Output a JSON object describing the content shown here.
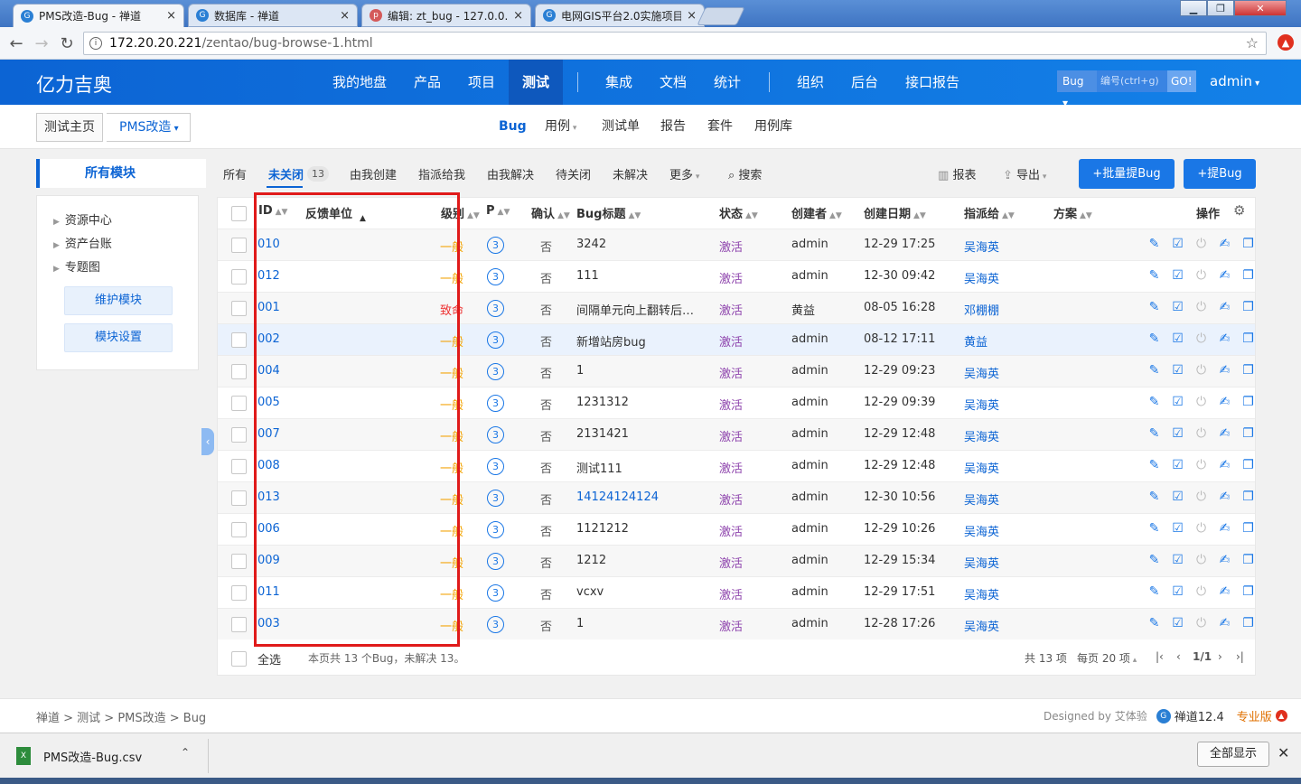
{
  "browser": {
    "tabs": [
      {
        "title": "PMS改造-Bug - 禅道",
        "active": true
      },
      {
        "title": "数据库 - 禅道",
        "active": false
      },
      {
        "title": "编辑: zt_bug - 127.0.0.1",
        "active": false
      },
      {
        "title": "电网GIS平台2.0实施项目",
        "active": false
      }
    ],
    "close_glyph": "×",
    "url_host": "172.20.20.221",
    "url_path": "/zentao/bug-browse-1.html"
  },
  "app": {
    "brand": "亿力吉奥",
    "nav": [
      "我的地盘",
      "产品",
      "项目",
      "测试",
      "集成",
      "文档",
      "统计",
      "组织",
      "后台",
      "接口报告"
    ],
    "active_nav": "测试",
    "search_type": "Bug",
    "search_placeholder": "编号(ctrl+g)",
    "search_go": "GO!",
    "user": "admin"
  },
  "subheader": {
    "home": "测试主页",
    "project": "PMS改造",
    "nav": [
      "Bug",
      "用例",
      "测试单",
      "报告",
      "套件",
      "用例库"
    ]
  },
  "sidebar": {
    "title": "所有模块",
    "tree": [
      "资源中心",
      "资产台账",
      "专题图"
    ],
    "maintain_btn": "维护模块",
    "settings_btn": "模块设置"
  },
  "filters": {
    "tabs": [
      "所有",
      "未关闭",
      "由我创建",
      "指派给我",
      "由我解决",
      "待关闭",
      "未解决",
      "更多"
    ],
    "unclosed_count": "13",
    "search": "搜索",
    "report": "报表",
    "export": "导出",
    "batch_btn": "+批量提Bug",
    "new_btn": "+提Bug"
  },
  "table": {
    "headers": {
      "id": "ID",
      "feedback": "反馈单位",
      "severity": "级别",
      "pri": "P",
      "confirm": "确认",
      "title": "Bug标题",
      "status": "状态",
      "creator": "创建者",
      "date": "创建日期",
      "assign": "指派给",
      "resolution": "方案",
      "actions": "操作"
    },
    "rows": [
      {
        "id": "010",
        "severity": "一般",
        "pri": "3",
        "confirmed": "否",
        "title": "3242",
        "status": "激活",
        "creator": "admin",
        "date": "12-29 17:25",
        "assigned": "吴海英"
      },
      {
        "id": "012",
        "severity": "一般",
        "pri": "3",
        "confirmed": "否",
        "title": "111",
        "status": "激活",
        "creator": "admin",
        "date": "12-30 09:42",
        "assigned": "吴海英"
      },
      {
        "id": "001",
        "severity": "致命",
        "pri": "3",
        "confirmed": "否",
        "title": "间隔单元向上翻转后…",
        "status": "激活",
        "creator": "黄益",
        "date": "08-05 16:28",
        "assigned": "邓棚棚"
      },
      {
        "id": "002",
        "severity": "一般",
        "pri": "3",
        "confirmed": "否",
        "title": "新增站房bug",
        "status": "激活",
        "creator": "admin",
        "date": "08-12 17:11",
        "assigned": "黄益"
      },
      {
        "id": "004",
        "severity": "一般",
        "pri": "3",
        "confirmed": "否",
        "title": "1",
        "status": "激活",
        "creator": "admin",
        "date": "12-29 09:23",
        "assigned": "吴海英"
      },
      {
        "id": "005",
        "severity": "一般",
        "pri": "3",
        "confirmed": "否",
        "title": "1231312",
        "status": "激活",
        "creator": "admin",
        "date": "12-29 09:39",
        "assigned": "吴海英"
      },
      {
        "id": "007",
        "severity": "一般",
        "pri": "3",
        "confirmed": "否",
        "title": "2131421",
        "status": "激活",
        "creator": "admin",
        "date": "12-29 12:48",
        "assigned": "吴海英"
      },
      {
        "id": "008",
        "severity": "一般",
        "pri": "3",
        "confirmed": "否",
        "title": "测试111",
        "status": "激活",
        "creator": "admin",
        "date": "12-29 12:48",
        "assigned": "吴海英"
      },
      {
        "id": "013",
        "severity": "一般",
        "pri": "3",
        "confirmed": "否",
        "title": "14124124124",
        "status": "激活",
        "creator": "admin",
        "date": "12-30 10:56",
        "assigned": "吴海英"
      },
      {
        "id": "006",
        "severity": "一般",
        "pri": "3",
        "confirmed": "否",
        "title": "1121212",
        "status": "激活",
        "creator": "admin",
        "date": "12-29 10:26",
        "assigned": "吴海英"
      },
      {
        "id": "009",
        "severity": "一般",
        "pri": "3",
        "confirmed": "否",
        "title": "1212",
        "status": "激活",
        "creator": "admin",
        "date": "12-29 15:34",
        "assigned": "吴海英"
      },
      {
        "id": "011",
        "severity": "一般",
        "pri": "3",
        "confirmed": "否",
        "title": "vcxv",
        "status": "激活",
        "creator": "admin",
        "date": "12-29 17:51",
        "assigned": "吴海英"
      },
      {
        "id": "003",
        "severity": "一般",
        "pri": "3",
        "confirmed": "否",
        "title": "1",
        "status": "激活",
        "creator": "admin",
        "date": "12-28 17:26",
        "assigned": "吴海英"
      }
    ],
    "select_all": "全选",
    "summary": "本页共 13 个Bug，未解决 13。",
    "pager_total": "共 13 项",
    "pager_per": "每页 20 项",
    "pager_page": "1/1"
  },
  "footer": {
    "breadcrumb": "禅道 > 测试 > PMS改造 > Bug",
    "designed": "Designed by 艾体验",
    "version": "禅道12.4",
    "edition": "专业版"
  },
  "download": {
    "file": "PMS改造-Bug.csv",
    "show_all": "全部显示"
  },
  "colors": {
    "brand_blue": "#0c64d4",
    "severity_normal": "#f3a000",
    "severity_fatal": "#e33333",
    "status_active": "#8e44ad",
    "highlight_box": "#e01a1a"
  }
}
